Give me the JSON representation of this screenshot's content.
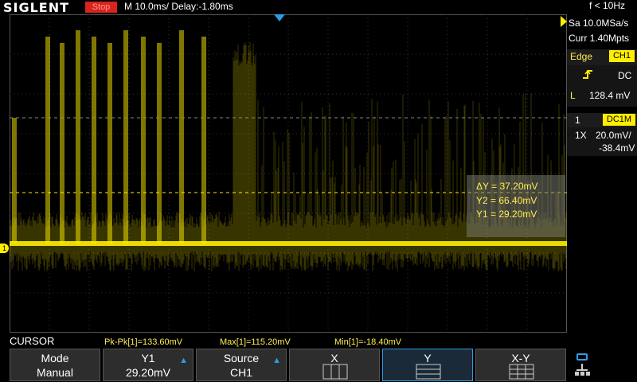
{
  "header": {
    "logo": "SIGLENT",
    "status": "Stop",
    "timebase": "M 10.0ms/ Delay:-1.80ms",
    "frequency": "f < 10Hz"
  },
  "acquisition": {
    "sample_rate": "Sa 10.0MSa/s",
    "memory": "Curr 1.40Mpts"
  },
  "trigger": {
    "type": "Edge",
    "source": "CH1",
    "slope_icon": "rising-edge-icon",
    "coupling": "DC",
    "level_label": "L",
    "level": "128.4 mV"
  },
  "channel": {
    "number": "1",
    "coupling": "DC1M",
    "probe": "1X",
    "scale": "20.0mV/",
    "offset": "-38.4mV",
    "marker": "1",
    "color": "#ffee00"
  },
  "cursor_readout": {
    "delta_y": "ΔY = 37.20mV",
    "y2": "Y2 = 66.40mV",
    "y1": "Y1 = 29.20mV"
  },
  "measurements": {
    "title": "CURSOR",
    "pkpk": "Pk-Pk[1]=133.60mV",
    "max": "Max[1]=115.20mV",
    "min": "Min[1]=-18.40mV"
  },
  "softkeys": [
    {
      "label": "Mode",
      "value": "Manual"
    },
    {
      "label": "Y1",
      "value": "29.20mV"
    },
    {
      "label": "Source",
      "value": "CH1"
    },
    {
      "label": "X",
      "value": ""
    },
    {
      "label": "Y",
      "value": ""
    },
    {
      "label": "X-Y",
      "value": ""
    }
  ],
  "colors": {
    "trace": "#ffee00",
    "stop": "#d8231f",
    "selected": "#2d9be8"
  }
}
